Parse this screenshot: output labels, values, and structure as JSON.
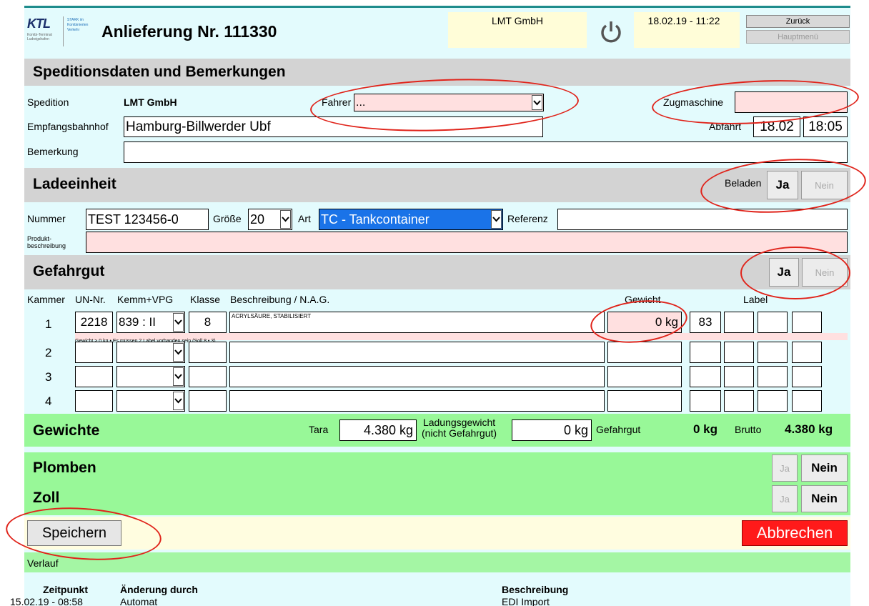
{
  "header": {
    "title": "Anlieferung Nr. 111330",
    "company": "LMT GmbH",
    "datetime": "18.02.19 - 11:22",
    "back_label": "Zurück",
    "mainmenu_label": "Hauptmenü",
    "logo_text": "KTL",
    "logo_subtext": "Kombi-Terminal Ludwigshafen",
    "brand_text": "STARK im Kombinierten Verkehr"
  },
  "speditionsdaten": {
    "title": "Speditionsdaten und Bemerkungen",
    "spedition_label": "Spedition",
    "spedition_value": "LMT GmbH",
    "fahrer_label": "Fahrer",
    "fahrer_value": "...",
    "zugmaschine_label": "Zugmaschine",
    "zugmaschine_value": "",
    "empfangsbahnhof_label": "Empfangsbahnhof",
    "empfangsbahnhof_value": "Hamburg-Billwerder Ubf",
    "abfahrt_label": "Abfahrt",
    "abfahrt_date": "18.02",
    "abfahrt_time": "18:05",
    "bemerkung_label": "Bemerkung",
    "bemerkung_value": ""
  },
  "ladeeinheit": {
    "title": "Ladeeinheit",
    "beladen_label": "Beladen",
    "ja_label": "Ja",
    "nein_label": "Nein",
    "nummer_label": "Nummer",
    "nummer_value": "TEST 123456-0",
    "groesse_label": "Größe",
    "groesse_value": "20",
    "art_label": "Art",
    "art_value": "TC - Tankcontainer",
    "referenz_label": "Referenz",
    "referenz_value": "",
    "produkt_label_1": "Produkt-",
    "produkt_label_2": "beschreibung",
    "produkt_value": ""
  },
  "gefahrgut": {
    "title": "Gefahrgut",
    "ja_label": "Ja",
    "nein_label": "Nein",
    "columns": {
      "kammer": "Kammer",
      "un_nr": "UN-Nr.",
      "kemm_vpg": "Kemm+VPG",
      "klasse": "Klasse",
      "beschreibung": "Beschreibung / N.A.G.",
      "gewicht": "Gewicht",
      "label": "Label"
    },
    "rows": [
      {
        "kammer": "1",
        "un_nr": "2218",
        "kemm": "839 : II",
        "klasse": "8",
        "beschreibung": "ACRYLSÄURE, STABILISIERT",
        "gewicht": "0 kg",
        "label1": "83",
        "label2": "",
        "label3": "",
        "label4": ""
      },
      {
        "kammer": "2",
        "un_nr": "",
        "kemm": "",
        "klasse": "",
        "beschreibung": "",
        "gewicht": "",
        "label1": "",
        "label2": "",
        "label3": "",
        "label4": ""
      },
      {
        "kammer": "3",
        "un_nr": "",
        "kemm": "",
        "klasse": "",
        "beschreibung": "",
        "gewicht": "",
        "label1": "",
        "label2": "",
        "label3": "",
        "label4": ""
      },
      {
        "kammer": "4",
        "un_nr": "",
        "kemm": "",
        "klasse": "",
        "beschreibung": "",
        "gewicht": "",
        "label1": "",
        "label2": "",
        "label3": "",
        "label4": ""
      }
    ],
    "warning": "Gewicht > 0 kg • Es müssen 2 Label vorhanden sein (Soll 8 • 3)"
  },
  "gewichte": {
    "title": "Gewichte",
    "tara_label": "Tara",
    "tara_value": "4.380 kg",
    "ladung_label_1": "Ladungsgewicht",
    "ladung_label_2": "(nicht Gefahrgut)",
    "ladung_value": "0 kg",
    "gefahrgut_label": "Gefahrgut",
    "gefahrgut_value": "0 kg",
    "brutto_label": "Brutto",
    "brutto_value": "4.380 kg"
  },
  "plomben": {
    "title": "Plomben",
    "ja_label": "Ja",
    "nein_label": "Nein"
  },
  "zoll": {
    "title": "Zoll",
    "ja_label": "Ja",
    "nein_label": "Nein"
  },
  "actions": {
    "save_label": "Speichern",
    "cancel_label": "Abbrechen"
  },
  "verlauf": {
    "title": "Verlauf",
    "columns": {
      "zeitpunkt": "Zeitpunkt",
      "aenderung": "Änderung durch",
      "beschreibung": "Beschreibung"
    },
    "rows": [
      {
        "zeitpunkt": "15.02.19 - 08:58",
        "aenderung": "Automat",
        "beschreibung": "EDI Import"
      }
    ]
  },
  "colors": {
    "accent": "#1e8c8c",
    "section_gray": "#d3d3d3",
    "section_green": "#98f898",
    "background": "#e3fbfd",
    "error_field": "#ffe0e0",
    "cancel_red": "#ff1a1a",
    "annotation_red": "#e0241b",
    "select_blue": "#1a73e8"
  },
  "icons": {
    "power": "power-icon",
    "dropdown": "chevron-down-icon",
    "logo": "ktl-logo-icon"
  }
}
